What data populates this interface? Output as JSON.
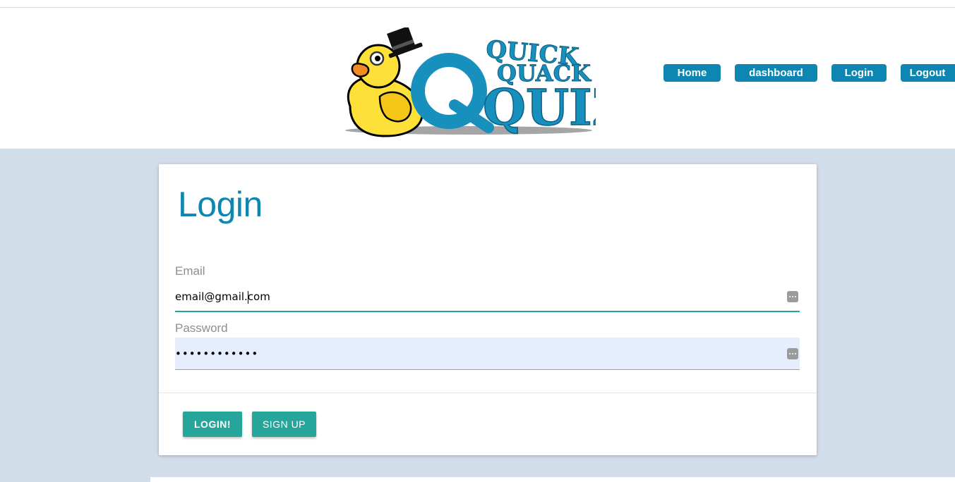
{
  "header": {
    "logo": {
      "line1": "QUICK",
      "line2": "QUACK",
      "line3": "QUIZ"
    },
    "nav": [
      {
        "label": "Home"
      },
      {
        "label": "dashboard"
      },
      {
        "label": "Login"
      },
      {
        "label": "Logout"
      }
    ]
  },
  "login_card": {
    "title": "Login",
    "email": {
      "label": "Email",
      "value": "email@gmail.com"
    },
    "password": {
      "label": "Password",
      "masked_value": "••••••••••••"
    },
    "actions": {
      "login_label": "LOGIN!",
      "signup_label": "SIGN UP"
    }
  },
  "colors": {
    "brand_blue": "#0d87b1",
    "teal_accent": "#26a69a",
    "page_background": "#d1dde8",
    "autofill_background": "#e6eefe"
  },
  "icons": {
    "password_manager": "key-icon"
  }
}
